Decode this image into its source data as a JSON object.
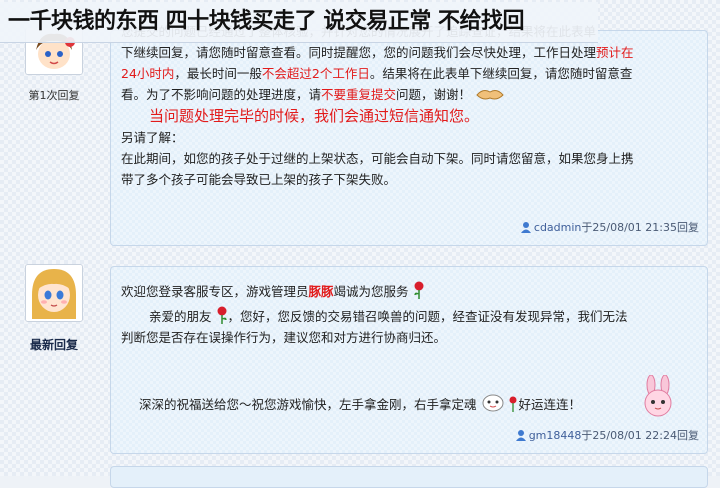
{
  "banner": {
    "text": "一千块钱的东西 四十块钱买走了 说交易正常 不给找回"
  },
  "post1": {
    "floor_label": "第1次回复",
    "line0": "您提交的问题已经通过了整体核验，并针对您的情况展开了追踪查证，结果将在此表单",
    "line1": "下继续回复，请您随时留意查看。同时提醒您，您的问题我们会尽快处理，工作日处理",
    "line1_red": "预计在",
    "line2_red": "24小时内",
    "line2_a": "，最长时间一般",
    "line2_red2": "不会超过2个工作日",
    "line2_b": "。结果将在此表单下继续回复，请您随时留意查",
    "line3_a": "看。为了不影响问题的处理进度，请",
    "line3_red": "不要重复提交",
    "line3_b": "问题，谢谢！",
    "notice": "当问题处理完毕的时候，我们会通过短信通知您。",
    "also": "另请了解：",
    "line5": "在此期间，如您的孩子处于过继的上架状态，可能会自动下架。同时请您留意，如果您身上携",
    "line6": "带了多个孩子可能会导致已上架的孩子下架失败。",
    "meta_user": "cdadmin",
    "meta_time": "于25/08/01 21:35回复"
  },
  "post2": {
    "floor_label": "最新回复",
    "greet_a": "欢迎您登录客服专区，游戏管理员",
    "greet_name": "豚豚",
    "greet_b": "竭诚为您服务",
    "body_a": "亲爱的朋友",
    "body_b": "，您好，您反馈的交易错召唤兽的问题，经查证没有发现异常，我们无法",
    "body_c": "判断您是否存在误操作行为，建议您和对方进行协商归还。",
    "wish_a": "深深的祝福送给您～祝您游戏愉快，左手拿金刚，右手拿定魂",
    "wish_b": "好运连连！",
    "meta_user": "gm18448",
    "meta_time": "于25/08/01 22:24回复"
  },
  "colors": {
    "accent_red": "#e21b1b",
    "bubble_bg": "#e4f0fa"
  },
  "icons": [
    "girl-avatar-icon",
    "doll-avatar-icon",
    "user-icon",
    "rose-icon",
    "handshake-icon",
    "sheep-icon",
    "bunny-icon"
  ]
}
